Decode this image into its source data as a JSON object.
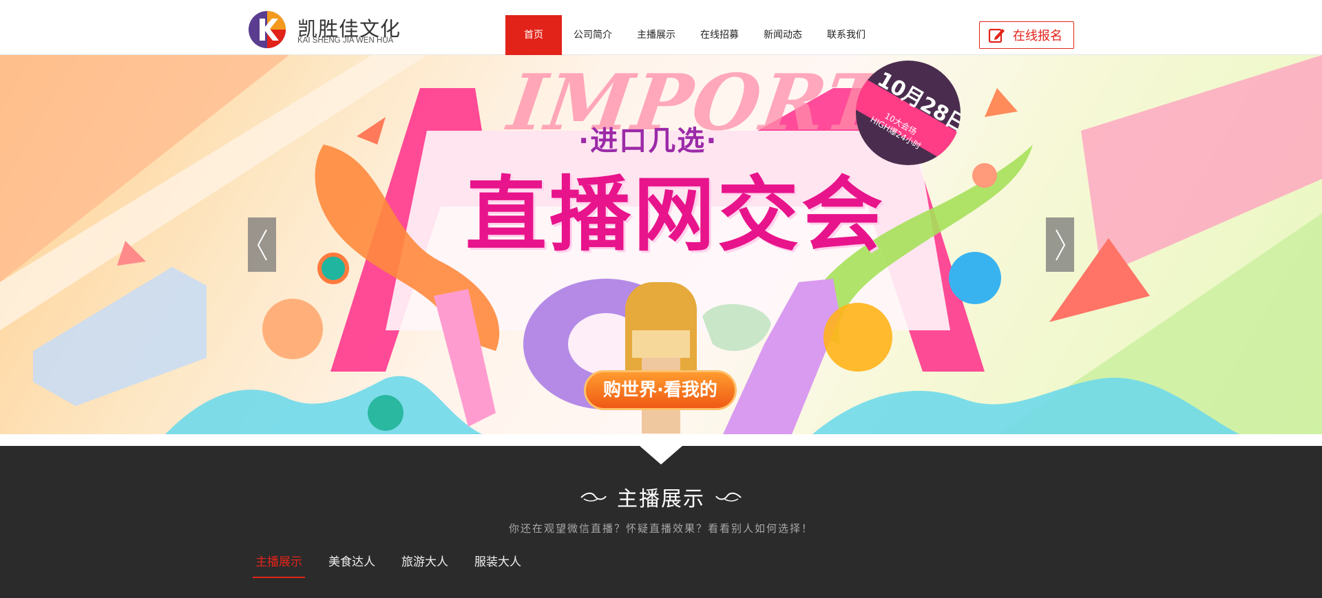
{
  "brand": {
    "name_cn": "凯胜佳文化",
    "name_en": "KAI SHENG JIA WEN HUA",
    "colors": {
      "accent": "#e2231a",
      "logo_orange": "#f39a1e",
      "logo_purple": "#5a3d8f"
    }
  },
  "nav": {
    "items": [
      {
        "label": "首页",
        "active": true
      },
      {
        "label": "公司简介"
      },
      {
        "label": "主播展示"
      },
      {
        "label": "在线招募"
      },
      {
        "label": "新闻动态"
      },
      {
        "label": "联系我们"
      }
    ]
  },
  "signup": {
    "label": "在线报名",
    "icon": "edit-icon"
  },
  "banner": {
    "import_text": "IMPORT",
    "subtitle": "·进口几选·",
    "headline": "直播网交会",
    "date": "10月28日",
    "date_sub_1": "10大会场",
    "date_sub_2": "HIGH爆24小时",
    "slogan": "购世界·看我的",
    "prev_icon": "chevron-left-icon",
    "next_icon": "chevron-right-icon"
  },
  "section": {
    "title": "主播展示",
    "subtitle": "你还在观望微信直播？怀疑直播效果？看看别人如何选择！",
    "tabs": [
      {
        "label": "主播展示",
        "active": true
      },
      {
        "label": "美食达人"
      },
      {
        "label": "旅游大人"
      },
      {
        "label": "服装大人"
      }
    ]
  }
}
